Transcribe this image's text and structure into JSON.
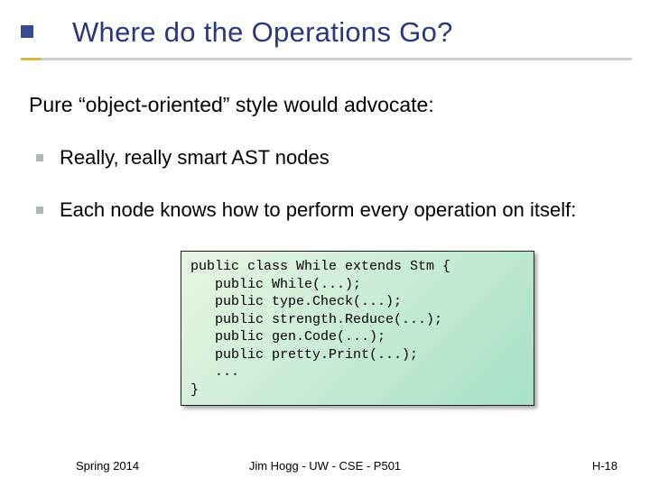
{
  "title": "Where do the Operations Go?",
  "subtitle": "Pure “object-oriented” style would advocate:",
  "bullets": [
    "Really, really smart AST nodes",
    "Each node knows how to perform every operation on itself:"
  ],
  "code": "public class While extends Stm {\n   public While(...);\n   public type.Check(...);\n   public strength.Reduce(...);\n   public gen.Code(...);\n   public pretty.Print(...);\n   ...\n}",
  "footer": {
    "left": "Spring 2014",
    "center": "Jim Hogg - UW - CSE - P501",
    "right": "H-18"
  }
}
